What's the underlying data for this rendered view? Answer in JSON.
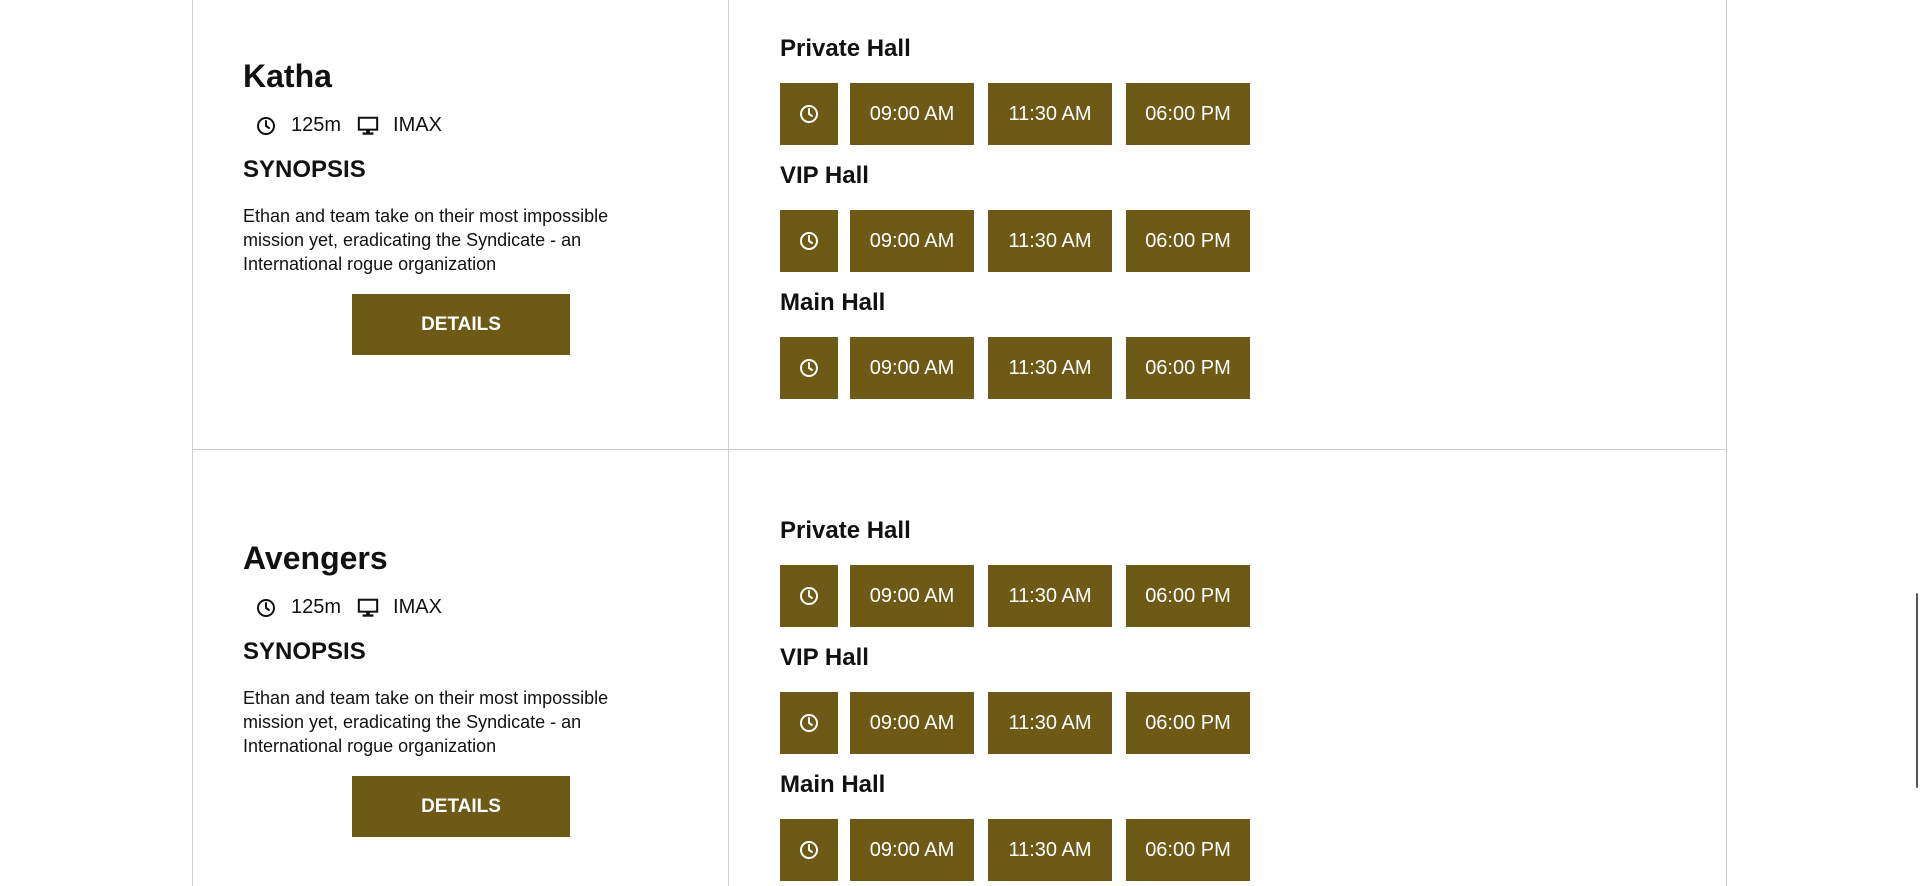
{
  "movies": [
    {
      "title": "Katha",
      "duration": "125m",
      "format": "IMAX",
      "synopsis_heading": "SYNOPSIS",
      "synopsis": "Ethan and team take on their most impossible mission yet, eradicating the Syndicate - an International rogue organization",
      "details_label": "DETAILS",
      "halls": [
        {
          "name": "Private Hall",
          "times": [
            "09:00 AM",
            "11:30 AM",
            "06:00 PM"
          ]
        },
        {
          "name": "VIP Hall",
          "times": [
            "09:00 AM",
            "11:30 AM",
            "06:00 PM"
          ]
        },
        {
          "name": "Main Hall",
          "times": [
            "09:00 AM",
            "11:30 AM",
            "06:00 PM"
          ]
        }
      ]
    },
    {
      "title": "Avengers",
      "duration": "125m",
      "format": "IMAX",
      "synopsis_heading": "SYNOPSIS",
      "synopsis": "Ethan and team take on their most impossible mission yet, eradicating the Syndicate - an International rogue organization",
      "details_label": "DETAILS",
      "halls": [
        {
          "name": "Private Hall",
          "times": [
            "09:00 AM",
            "11:30 AM",
            "06:00 PM"
          ]
        },
        {
          "name": "VIP Hall",
          "times": [
            "09:00 AM",
            "11:30 AM",
            "06:00 PM"
          ]
        },
        {
          "name": "Main Hall",
          "times": [
            "09:00 AM",
            "11:30 AM",
            "06:00 PM"
          ]
        }
      ]
    }
  ],
  "icons": {
    "duration": "clock-icon",
    "format": "monitor-icon",
    "slot": "clock-icon"
  },
  "colors": {
    "accent": "#6d5a17",
    "button_text": "#ffffff",
    "text": "#111111",
    "divider": "#cfcfcf"
  }
}
